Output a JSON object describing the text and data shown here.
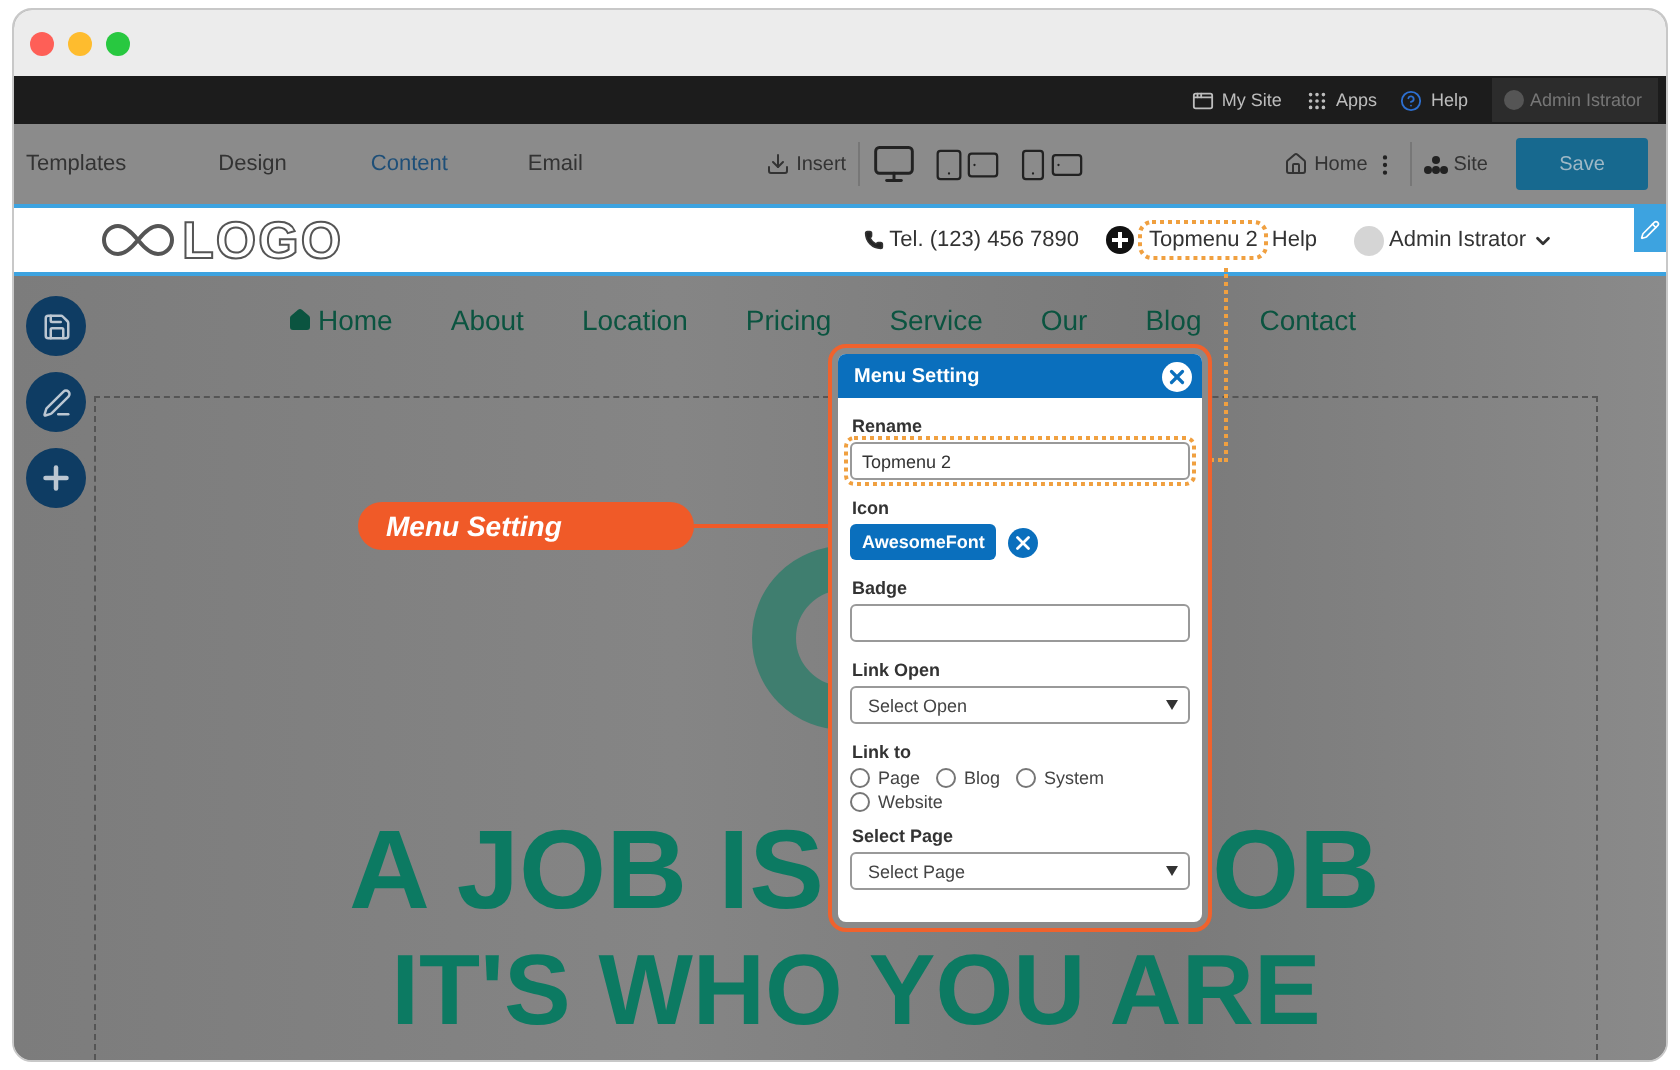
{
  "admin_bar": {
    "items": [
      {
        "kind": "window",
        "label": "My Site"
      },
      {
        "kind": "apps",
        "label": "Apps"
      },
      {
        "kind": "help",
        "label": "Help"
      }
    ],
    "user": "Admin Istrator"
  },
  "editor_tabs": [
    {
      "label": "Templates",
      "selected": false
    },
    {
      "label": "Design",
      "selected": false
    },
    {
      "label": "Content",
      "selected": true
    },
    {
      "label": "Email",
      "selected": false
    }
  ],
  "toolbar": {
    "insert": "Insert",
    "home": "Home",
    "site": "Site",
    "save": "Save"
  },
  "site_header": {
    "logo": "LOGO",
    "phone": "Tel. (123) 456 7890",
    "menu_item": {
      "label": "Topmenu 2",
      "highlighted": true
    },
    "help": "Help",
    "user": "Admin Istrator"
  },
  "nav": [
    {
      "kind": "home",
      "label": "Home"
    },
    {
      "kind": "plain",
      "label": "About"
    },
    {
      "kind": "plain",
      "label": "Location"
    },
    {
      "kind": "plain",
      "label": "Pricing"
    },
    {
      "kind": "plain",
      "label": "Service"
    },
    {
      "kind": "plain",
      "label": "Our"
    },
    {
      "kind": "plain",
      "label": "Blog"
    },
    {
      "kind": "plain",
      "label": "Contact"
    }
  ],
  "callout": "Menu Setting",
  "dialog": {
    "title": "Menu Setting",
    "fields": [
      {
        "kind": "text",
        "label": "Rename",
        "value": "Topmenu 2",
        "highlighted": true
      },
      {
        "kind": "chip",
        "label": "Icon",
        "value": "AwesomeFont",
        "highlighted": false
      },
      {
        "kind": "text",
        "label": "Badge",
        "highlighted": false
      },
      {
        "kind": "select",
        "label": "Link Open",
        "placeholder": "Select Open",
        "highlighted": false
      },
      {
        "kind": "radios",
        "label": "Link to",
        "highlighted": false,
        "options": [
          {
            "label": "Page",
            "selected": false
          },
          {
            "label": "Blog",
            "selected": false
          },
          {
            "label": "System",
            "selected": false
          },
          {
            "label": "Website",
            "selected": false
          }
        ]
      },
      {
        "kind": "select",
        "label": "Select Page",
        "placeholder": "Select Page",
        "highlighted": false
      }
    ]
  },
  "hero": {
    "line_1_left": "A JOB IS",
    "line_1_right": "OB",
    "line_2": "IT'S WHO YOU ARE"
  }
}
